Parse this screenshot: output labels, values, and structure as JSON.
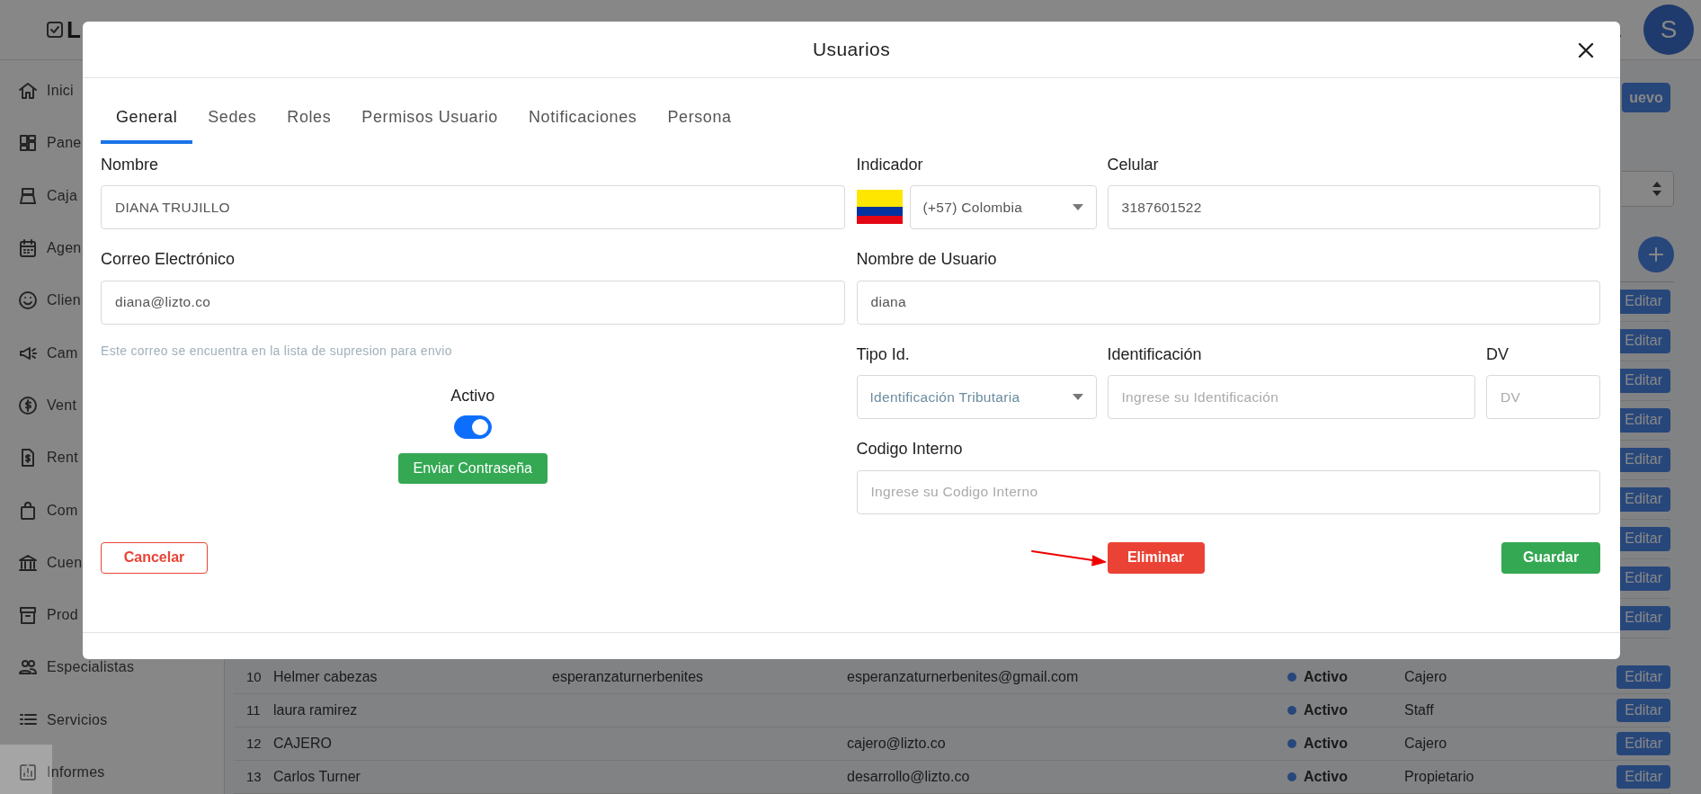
{
  "topbar": {
    "logo": "L",
    "avatar": "S"
  },
  "sidebar": {
    "items": [
      {
        "label": "Inici"
      },
      {
        "label": "Pane"
      },
      {
        "label": "Caja"
      },
      {
        "label": "Agen"
      },
      {
        "label": "Clien"
      },
      {
        "label": "Cam"
      },
      {
        "label": "Vent"
      },
      {
        "label": "Rent"
      },
      {
        "label": "Com"
      },
      {
        "label": "Cuen"
      },
      {
        "label": "Prod"
      },
      {
        "label": "Especialistas"
      },
      {
        "label": "Servicios"
      },
      {
        "label": "Informes"
      }
    ]
  },
  "page": {
    "new_button": "uevo",
    "table": {
      "rows": [
        {
          "action": "Editar"
        },
        {
          "action": "Editar"
        },
        {
          "action": "Editar"
        },
        {
          "action": "Editar"
        },
        {
          "action": "Editar"
        },
        {
          "action": "Editar"
        },
        {
          "action": "Editar"
        },
        {
          "action": "Editar"
        },
        {
          "action": "Editar"
        },
        {
          "number": "10",
          "name": "Helmer cabezas",
          "username": "esperanzaturnerbenites",
          "email": "esperanzaturnerbenites@gmail.com",
          "status": "Activo",
          "role": "Cajero",
          "action": "Editar"
        },
        {
          "number": "11",
          "name": "laura ramirez",
          "status": "Activo",
          "role": "Staff",
          "action": "Editar"
        },
        {
          "number": "12",
          "name": "CAJERO",
          "email": "cajero@lizto.co",
          "status": "Activo",
          "role": "Cajero",
          "action": "Editar"
        },
        {
          "number": "13",
          "name": "Carlos Turner",
          "email": "desarrollo@lizto.co",
          "status": "Activo",
          "role": "Propietario",
          "action": "Editar"
        }
      ]
    }
  },
  "modal": {
    "title": "Usuarios",
    "tabs": [
      {
        "label": "General",
        "selected": true
      },
      {
        "label": "Sedes",
        "selected": false
      },
      {
        "label": "Roles",
        "selected": false
      },
      {
        "label": "Permisos Usuario",
        "selected": false
      },
      {
        "label": "Notificaciones",
        "selected": false
      },
      {
        "label": "Persona",
        "selected": false
      }
    ],
    "name_field": {
      "label": "Nombre",
      "value": "DIANA TRUJILLO"
    },
    "email_field": {
      "label": "Correo Electrónico",
      "value": "diana@lizto.co",
      "note": "Este correo se encuentra en la lista de supresion para envio"
    },
    "active": {
      "label": "Activo",
      "on": true
    },
    "send_password_button": "Enviar Contraseña",
    "indicator": {
      "label": "Indicador",
      "value": "(+57) Colombia"
    },
    "phone": {
      "label": "Celular",
      "value": "3187601522"
    },
    "username": {
      "label": "Nombre de Usuario",
      "value": "diana"
    },
    "id_type": {
      "label": "Tipo Id.",
      "value": "Identificación Tributaria"
    },
    "id_number": {
      "label": "Identificación",
      "placeholder": "Ingrese su Identificación"
    },
    "dv": {
      "label": "DV",
      "placeholder": "DV"
    },
    "internal_code": {
      "label": "Codigo Interno",
      "placeholder": "Ingrese su Codigo Interno"
    },
    "buttons": {
      "cancel": "Cancelar",
      "delete": "Eliminar",
      "save": "Guardar"
    }
  }
}
